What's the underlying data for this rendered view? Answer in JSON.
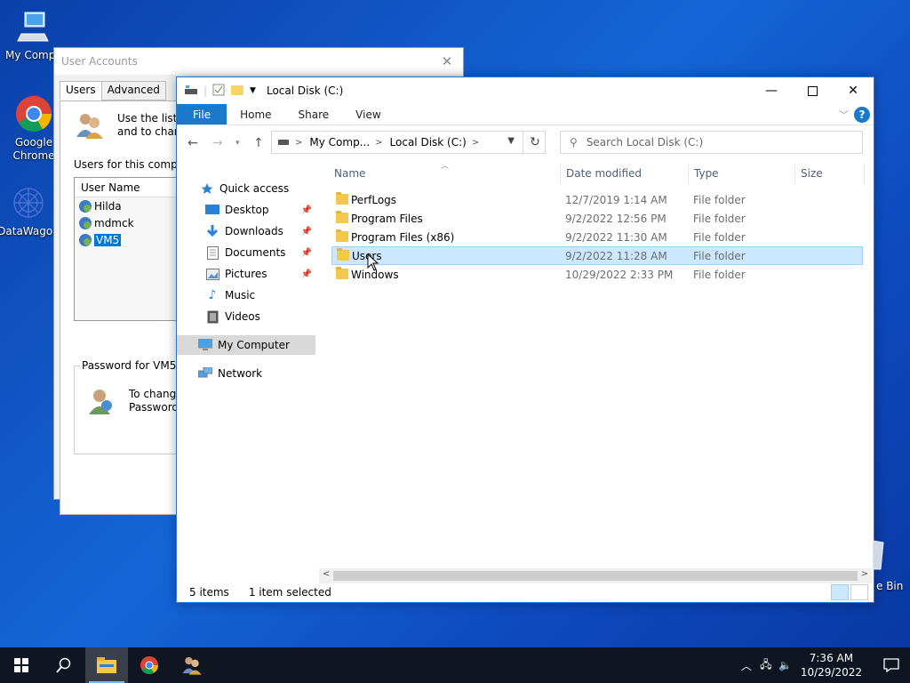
{
  "desktop": {
    "icons": [
      {
        "label": "My Compu"
      },
      {
        "label": "Google Chrome"
      },
      {
        "label": "DataWagon"
      }
    ],
    "recycle_label": "e Bin"
  },
  "user_accounts": {
    "title": "User Accounts",
    "tabs": [
      "Users",
      "Advanced"
    ],
    "description": "Use the list b\nand to chang",
    "users_label": "Users for this compute",
    "list_header": "User Name",
    "users": [
      "Hilda",
      "mdmck",
      "VM5"
    ],
    "selected_user": "VM5",
    "password_group": "Password for VM5",
    "password_text_1": "To change",
    "password_text_2": "Password."
  },
  "explorer": {
    "title": "Local Disk (C:)",
    "ribbon_tabs": [
      "File",
      "Home",
      "Share",
      "View"
    ],
    "breadcrumb": [
      "My Comp...",
      "Local Disk (C:)"
    ],
    "search_placeholder": "Search Local Disk (C:)",
    "nav": {
      "quick_access": "Quick access",
      "desktop": "Desktop",
      "downloads": "Downloads",
      "documents": "Documents",
      "pictures": "Pictures",
      "music": "Music",
      "videos": "Videos",
      "my_computer": "My Computer",
      "network": "Network"
    },
    "columns": {
      "name": "Name",
      "date": "Date modified",
      "type": "Type",
      "size": "Size"
    },
    "files": [
      {
        "name": "PerfLogs",
        "date": "12/7/2019 1:14 AM",
        "type": "File folder"
      },
      {
        "name": "Program Files",
        "date": "9/2/2022 12:56 PM",
        "type": "File folder"
      },
      {
        "name": "Program Files (x86)",
        "date": "9/2/2022 11:30 AM",
        "type": "File folder"
      },
      {
        "name": "Users",
        "date": "9/2/2022 11:28 AM",
        "type": "File folder"
      },
      {
        "name": "Windows",
        "date": "10/29/2022 2:33 PM",
        "type": "File folder"
      }
    ],
    "status_items": "5 items",
    "status_selected": "1 item selected"
  },
  "taskbar": {
    "time": "7:36 AM",
    "date": "10/29/2022"
  },
  "colors": {
    "accent": "#1979ca",
    "selection": "#cce8ff",
    "taskbar": "#101522"
  }
}
